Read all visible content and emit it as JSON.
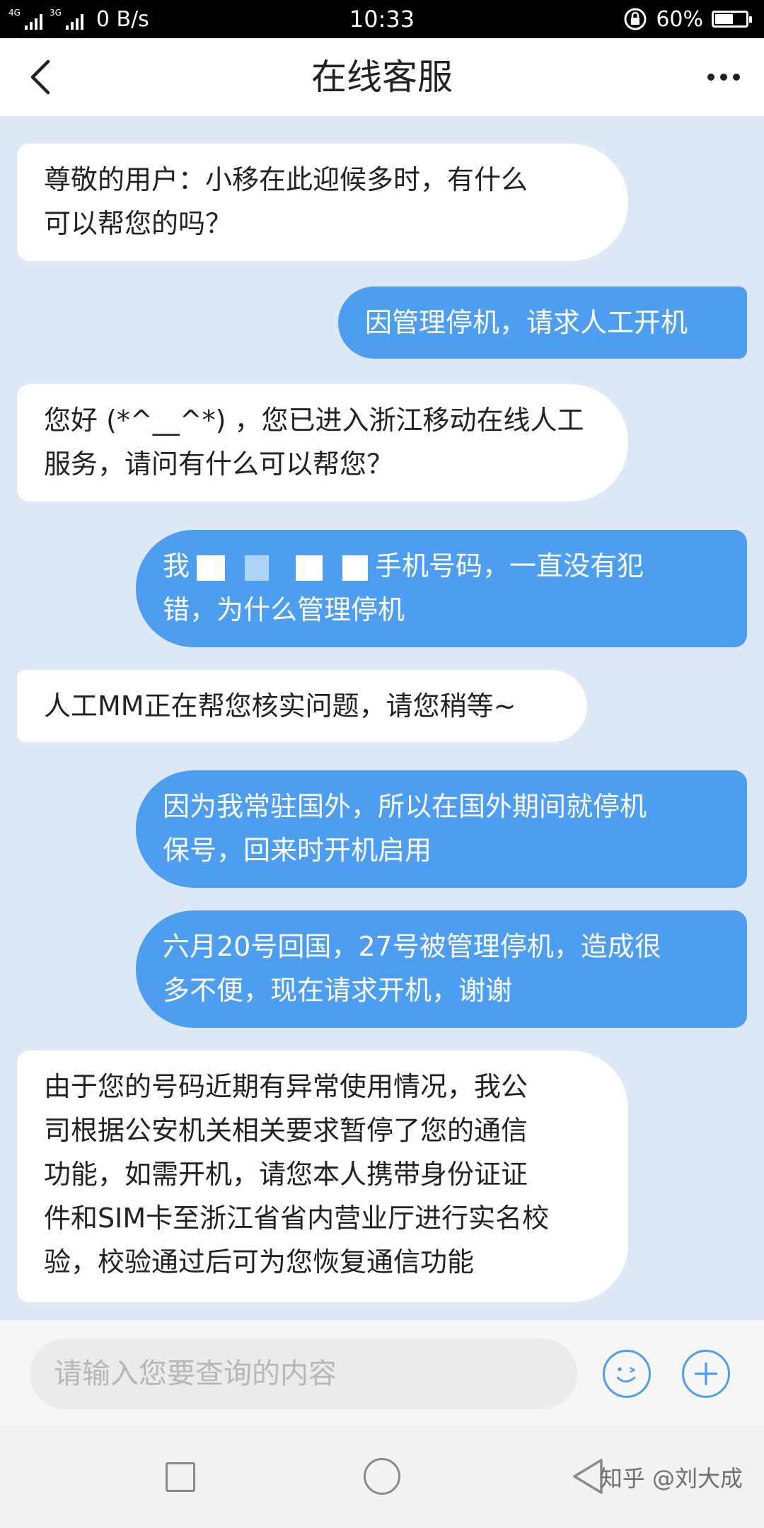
{
  "status_bar": {
    "network_1": "4G",
    "network_2": "3G",
    "net_speed": "0 B/s",
    "time": "10:33",
    "battery_percent_text": "60%",
    "battery_level": 0.6
  },
  "header": {
    "title": "在线客服",
    "back_icon": "chevron-left-icon",
    "more_icon": "more-horizontal-icon"
  },
  "messages": [
    {
      "sender": "agent",
      "line1": "尊敬的用户：小移在此迎候多时，有什么",
      "line2": "可以帮您的吗？"
    },
    {
      "sender": "user",
      "line1": "因管理停机，请求人工开机"
    },
    {
      "sender": "agent",
      "line1": "您好 (*^__^*) ，您已进入浙江移动在线人工",
      "line2": "服务，请问有什么可以帮您？"
    },
    {
      "sender": "user",
      "line1": "我",
      "line1_after": "手机号码，一直没有犯",
      "line2": "错，为什么管理停机"
    },
    {
      "sender": "agent",
      "line1": "人工MM正在帮您核实问题，请您稍等~"
    },
    {
      "sender": "user",
      "line1": "因为我常驻国外，所以在国外期间就停机",
      "line2": "保号，回来时开机启用"
    },
    {
      "sender": "user",
      "line1": "六月20号回国，27号被管理停机，造成很",
      "line2": "多不便，现在请求开机，谢谢"
    },
    {
      "sender": "agent",
      "line1": "由于您的号码近期有异常使用情况，我公",
      "line2": "司根据公安机关相关要求暂停了您的通信",
      "line3": "功能，如需开机，请您本人携带身份证证",
      "line4": "件和SIM卡至浙江省省内营业厅进行实名校",
      "line5": "验，校验通过后可为您恢复通信功能"
    }
  ],
  "input": {
    "placeholder": "请输入您要查询的内容",
    "emoji_icon": "emoji-icon",
    "plus_icon": "plus-icon"
  },
  "nav": {
    "recent_icon": "recent-apps-icon",
    "home_icon": "home-icon",
    "back_icon": "back-triangle-icon"
  },
  "watermark": "知乎 @刘大成",
  "colors": {
    "chat_background": "#dde9f6",
    "user_bubble": "#4d9ef0",
    "agent_bubble": "#ffffff",
    "accent": "#4d9ef0"
  }
}
